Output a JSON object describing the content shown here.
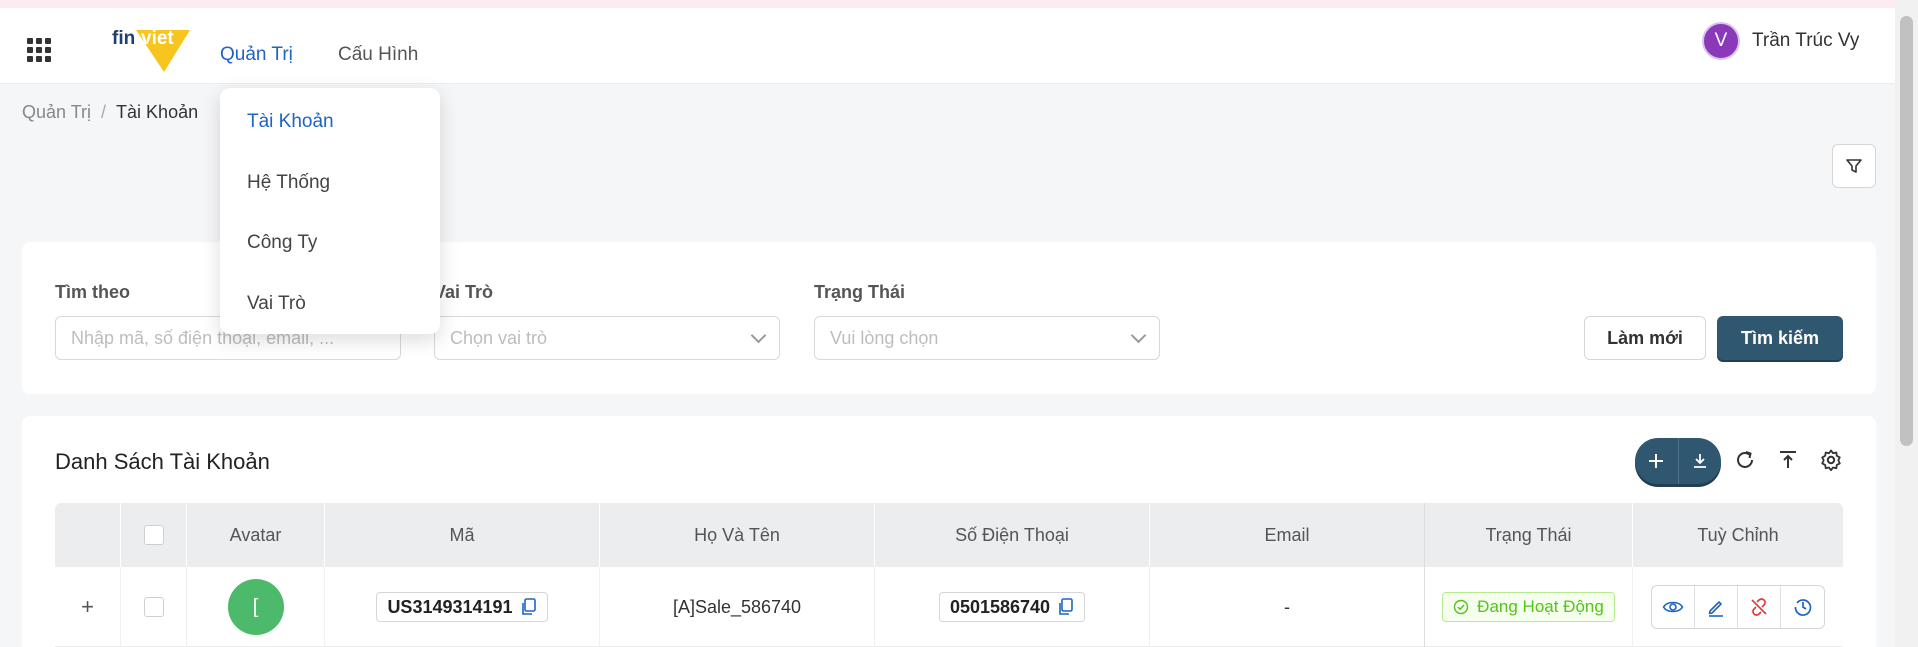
{
  "header": {
    "logo_text": "finviet",
    "nav": [
      {
        "label": "Quản Trị",
        "active": true
      },
      {
        "label": "Cấu Hình",
        "active": false
      }
    ],
    "user": {
      "initial": "V",
      "name": "Trần Trúc Vy"
    }
  },
  "breadcrumb": {
    "root": "Quản Trị",
    "separator": "/",
    "current": "Tài Khoản"
  },
  "dropdown": {
    "items": [
      {
        "label": "Tài Khoản",
        "active": true
      },
      {
        "label": "Hệ Thống",
        "active": false
      },
      {
        "label": "Công Ty",
        "active": false
      },
      {
        "label": "Vai Trò",
        "active": false
      }
    ]
  },
  "search": {
    "fields": [
      {
        "label": "Tìm theo",
        "placeholder": "Nhập mã, số điện thoại, email, ..."
      },
      {
        "label": "Vai Trò",
        "placeholder": "Chọn vai trò"
      },
      {
        "label": "Trạng Thái",
        "placeholder": "Vui lòng chọn"
      }
    ],
    "reset_label": "Làm mới",
    "search_label": "Tìm kiếm"
  },
  "list": {
    "title": "Danh Sách Tài Khoản",
    "columns": [
      "Avatar",
      "Mã",
      "Họ Và Tên",
      "Số Điện Thoại",
      "Email",
      "Trạng Thái",
      "Tuỳ Chỉnh"
    ],
    "rows": [
      {
        "avatar_initial": "[",
        "code": "US3149314191",
        "full_name": "[A]Sale_586740",
        "phone": "0501586740",
        "email": "-",
        "status": "Đang Hoạt Động"
      }
    ]
  },
  "colors": {
    "accent": "#1e64c8",
    "primary_button": "#2f5770",
    "avatar_user": "#8a3ab9",
    "avatar_row": "#4cba6a",
    "status_active": "#52c41a"
  },
  "icons": [
    "apps-grid-icon",
    "filter-icon",
    "plus-icon",
    "download-icon",
    "refresh-icon",
    "upload-icon",
    "settings-icon",
    "copy-icon",
    "check-circle-icon",
    "eye-icon",
    "edit-icon",
    "unlink-icon",
    "history-icon"
  ]
}
